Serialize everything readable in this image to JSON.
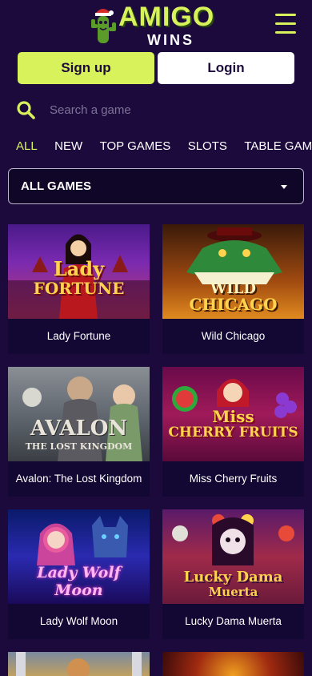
{
  "header": {
    "logo_primary": "AMIGO",
    "logo_secondary": "WINS",
    "menu_icon": "hamburger-menu-icon"
  },
  "auth": {
    "signup_label": "Sign up",
    "login_label": "Login"
  },
  "search": {
    "placeholder": "Search a game",
    "icon": "search-icon"
  },
  "tabs": [
    {
      "label": "ALL",
      "active": true
    },
    {
      "label": "NEW",
      "active": false
    },
    {
      "label": "TOP GAMES",
      "active": false
    },
    {
      "label": "SLOTS",
      "active": false
    },
    {
      "label": "TABLE GAMES",
      "active": false
    }
  ],
  "filter": {
    "selected": "ALL GAMES"
  },
  "games": [
    {
      "name": "Lady Fortune",
      "art_line1": "Lady",
      "art_line2": "FORTUNE"
    },
    {
      "name": "Wild Chicago",
      "art_line1": "WILD",
      "art_line2": "CHICAGO"
    },
    {
      "name": "Avalon: The Lost Kingdom",
      "art_line1": "AVALON",
      "art_line2": "THE LOST KINGDOM"
    },
    {
      "name": "Miss Cherry Fruits",
      "art_line1": "Miss",
      "art_line2": "CHERRY FRUITS"
    },
    {
      "name": "Lady Wolf Moon",
      "art_line1": "Lady Wolf",
      "art_line2": "Moon"
    },
    {
      "name": "Lucky Dama Muerta",
      "art_line1": "Lucky Dama",
      "art_line2": "Muerta"
    }
  ],
  "colors": {
    "background": "#1d0a3d",
    "accent": "#d7f25a",
    "card": "#130733"
  }
}
